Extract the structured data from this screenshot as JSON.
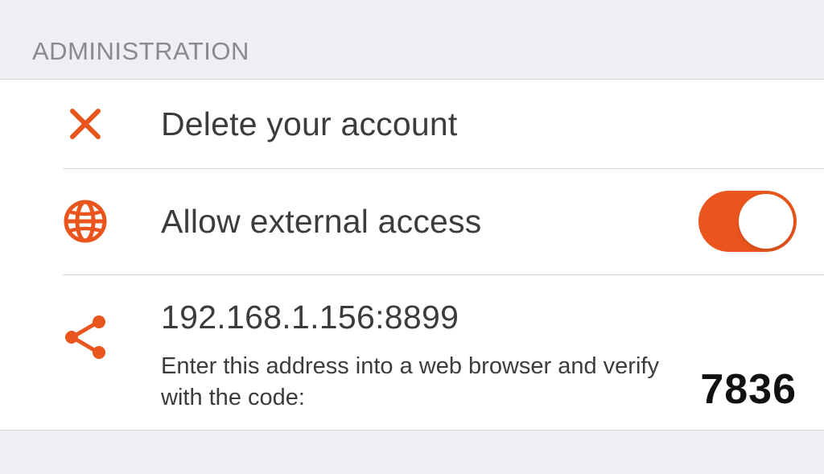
{
  "section": {
    "title": "ADMINISTRATION"
  },
  "rows": {
    "delete": {
      "label": "Delete your account"
    },
    "external": {
      "label": "Allow external access",
      "enabled": true
    },
    "share": {
      "address": "192.168.1.156:8899",
      "hint": "Enter this address into a web browser and verify with the code:",
      "code": "7836"
    }
  },
  "colors": {
    "accent": "#e9551c"
  }
}
